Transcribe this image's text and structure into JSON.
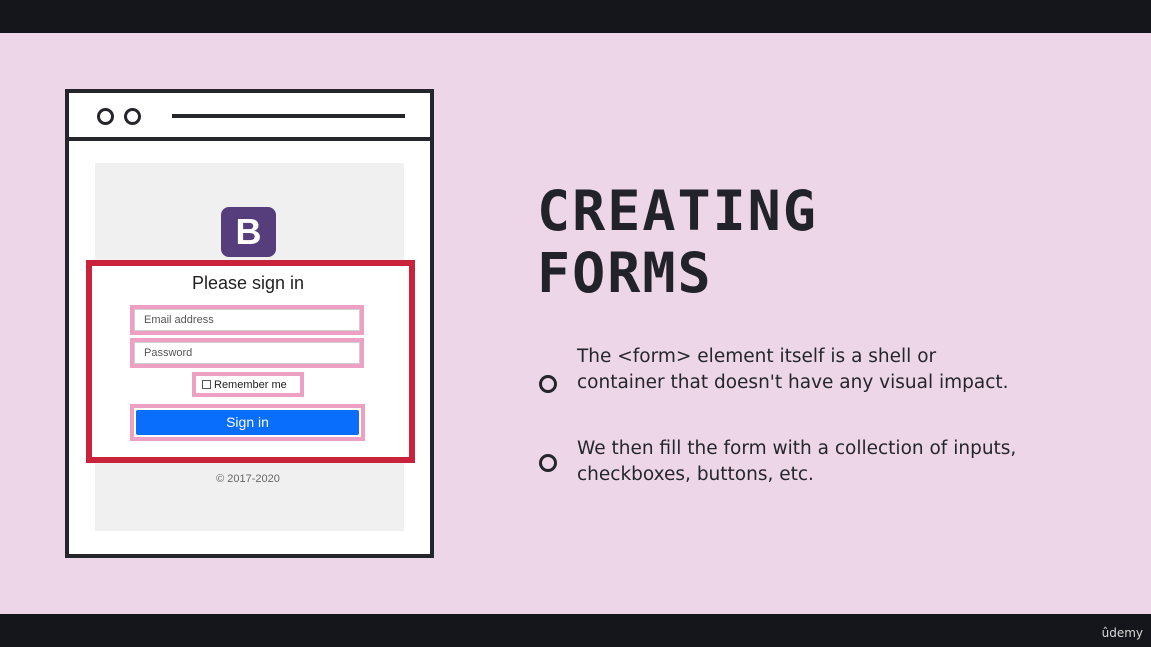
{
  "slide": {
    "heading_line1": "CREATING",
    "heading_line2": "FORMS",
    "bullets": [
      "The <form> element itself is a shell or container that doesn't have any visual impact.",
      "We then fill the form with a collection of inputs, checkboxes, buttons, etc."
    ]
  },
  "mock_form": {
    "logo_letter": "B",
    "title": "Please sign in",
    "email_placeholder": "Email address",
    "password_placeholder": "Password",
    "remember_label": "Remember me",
    "signin_label": "Sign in",
    "copyright": "© 2017-2020"
  },
  "branding": {
    "watermark": "ûdemy"
  },
  "colors": {
    "slide_background": "#ecd6e8",
    "frame": "#25262c",
    "form_highlight": "#c9223b",
    "field_highlight": "#ee9fc4",
    "primary_button": "#0a6efd",
    "bootstrap_purple": "#563d7c"
  },
  "icons": {
    "bullet": "ring-bullet-icon",
    "window_controls": "window-dot-icon"
  }
}
